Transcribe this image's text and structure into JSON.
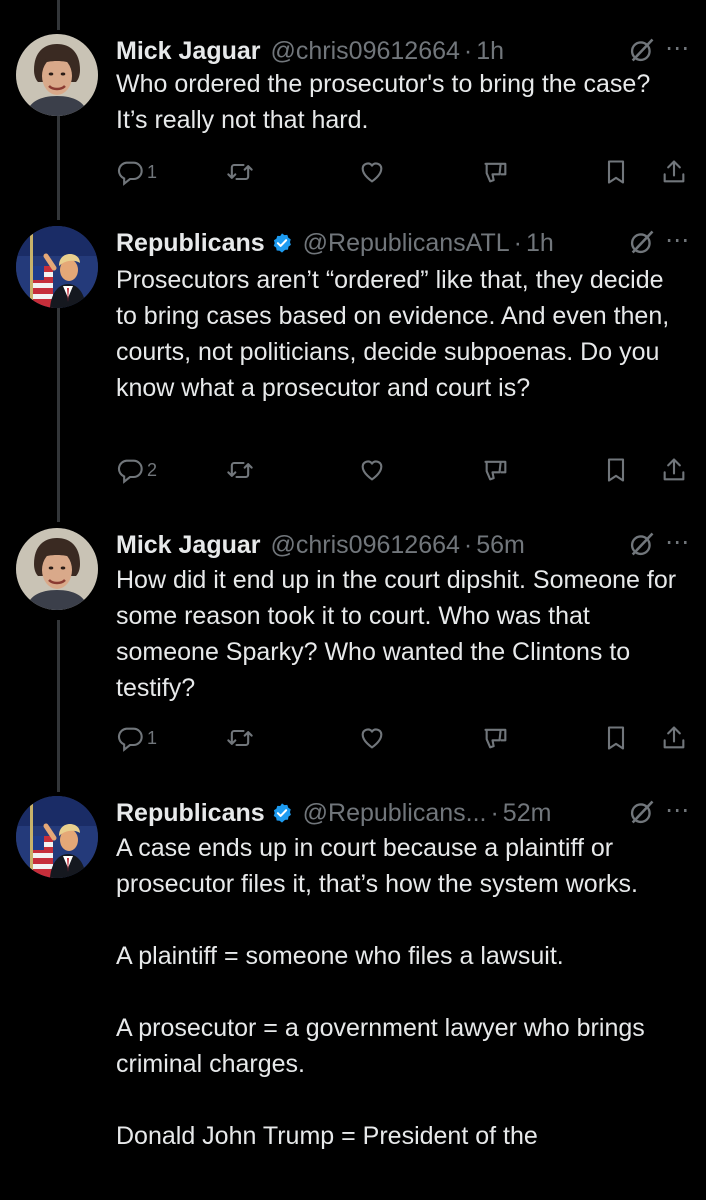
{
  "tweets": [
    {
      "name": "Mick Jaguar",
      "handle": "@chris09612664",
      "time": "1h",
      "verified": false,
      "text": "Who ordered the prosecutor's to bring the case? It’s really not that hard.",
      "reply_count": "1",
      "avatar": "mick-avatar"
    },
    {
      "name": "Republicans",
      "handle": "@RepublicansATL",
      "time": "1h",
      "verified": true,
      "text": "Prosecutors aren’t “ordered” like that, they decide to bring cases based on evidence. And even then, courts, not politicians, decide subpoenas. Do you know what a prosecutor and court is?",
      "reply_count": "2",
      "avatar": "trump-avatar"
    },
    {
      "name": "Mick Jaguar",
      "handle": "@chris09612664",
      "time": "56m",
      "verified": false,
      "text": "How did it end up in the court dipshit. Someone for some reason took it to court. Who was that someone Sparky? Who wanted the Clintons to testify?",
      "reply_count": "1",
      "avatar": "mick-avatar"
    },
    {
      "name": "Republicans",
      "handle": "@Republicans...",
      "time": "52m",
      "verified": true,
      "text": "A case ends up in court because a plaintiff or prosecutor files it, that’s how the system works.\n\nA plaintiff = someone who files a lawsuit.\n\nA prosecutor = a government lawyer who brings criminal charges.\n\nDonald John Trump = President of the",
      "avatar": "trump-avatar"
    }
  ],
  "icons": {
    "more": "⋯",
    "separator": "·"
  },
  "colors": {
    "background": "#000000",
    "text": "#e7e9ea",
    "secondary": "#71767b",
    "verified": "#1d9bf0",
    "thread_line": "#333639"
  }
}
